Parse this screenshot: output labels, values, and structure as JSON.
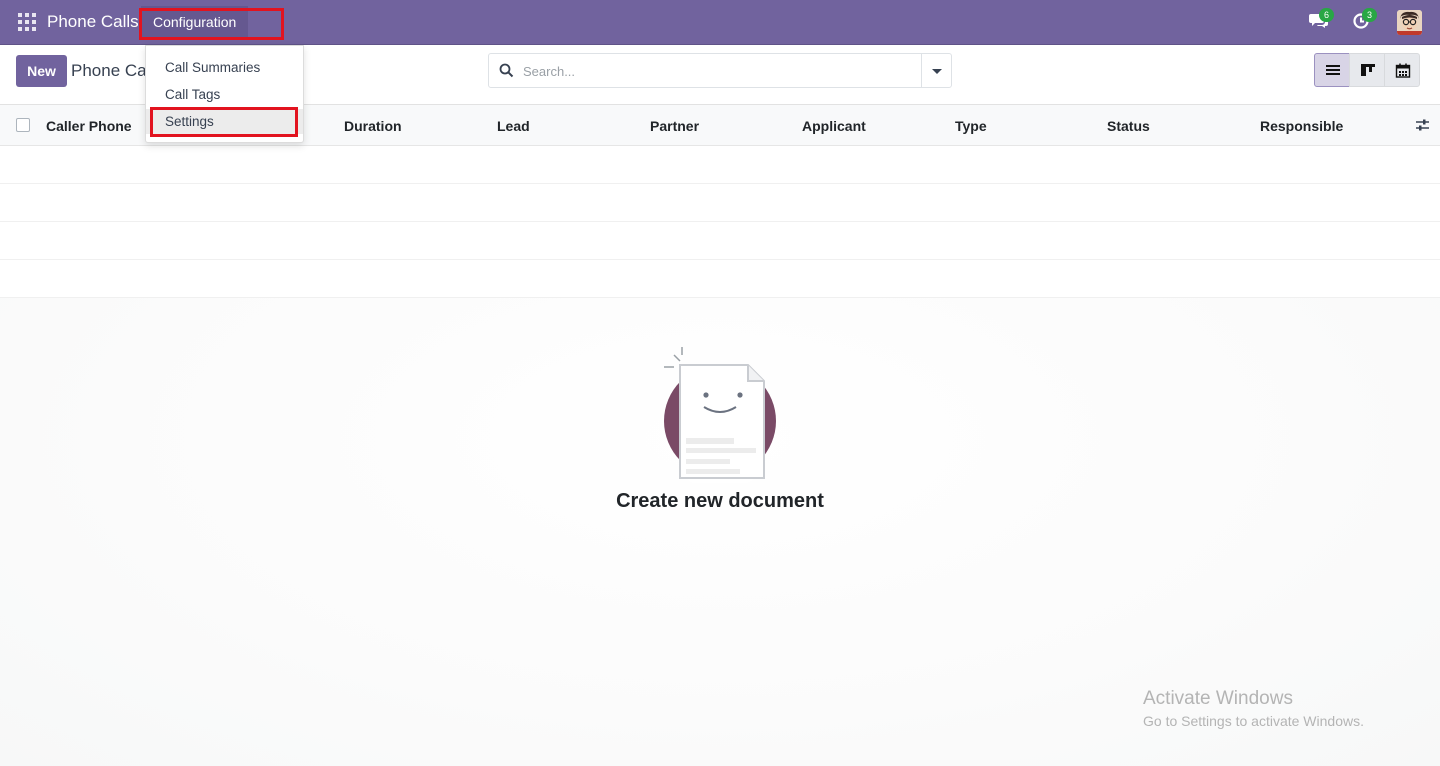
{
  "navbar": {
    "brand": "Phone Calls",
    "menu_configuration": "Configuration",
    "chat_badge": "6",
    "activity_badge": "3"
  },
  "control_panel": {
    "new_button": "New",
    "breadcrumb": "Phone Cal",
    "search_placeholder": "Search..."
  },
  "configuration_menu": {
    "items": [
      "Call Summaries",
      "Call Tags",
      "Settings"
    ]
  },
  "table": {
    "columns": [
      "Caller Phone",
      "Duration",
      "Lead",
      "Partner",
      "Applicant",
      "Type",
      "Status",
      "Responsible"
    ]
  },
  "empty_state": {
    "title": "Create new document"
  },
  "watermark": {
    "line1": "Activate Windows",
    "line2": "Go to Settings to activate Windows."
  },
  "colors": {
    "navbar": "#71639e",
    "primary": "#71639e",
    "badge": "#28a745",
    "highlight": "#e2131f",
    "illustration_circle": "#7a4a66"
  }
}
